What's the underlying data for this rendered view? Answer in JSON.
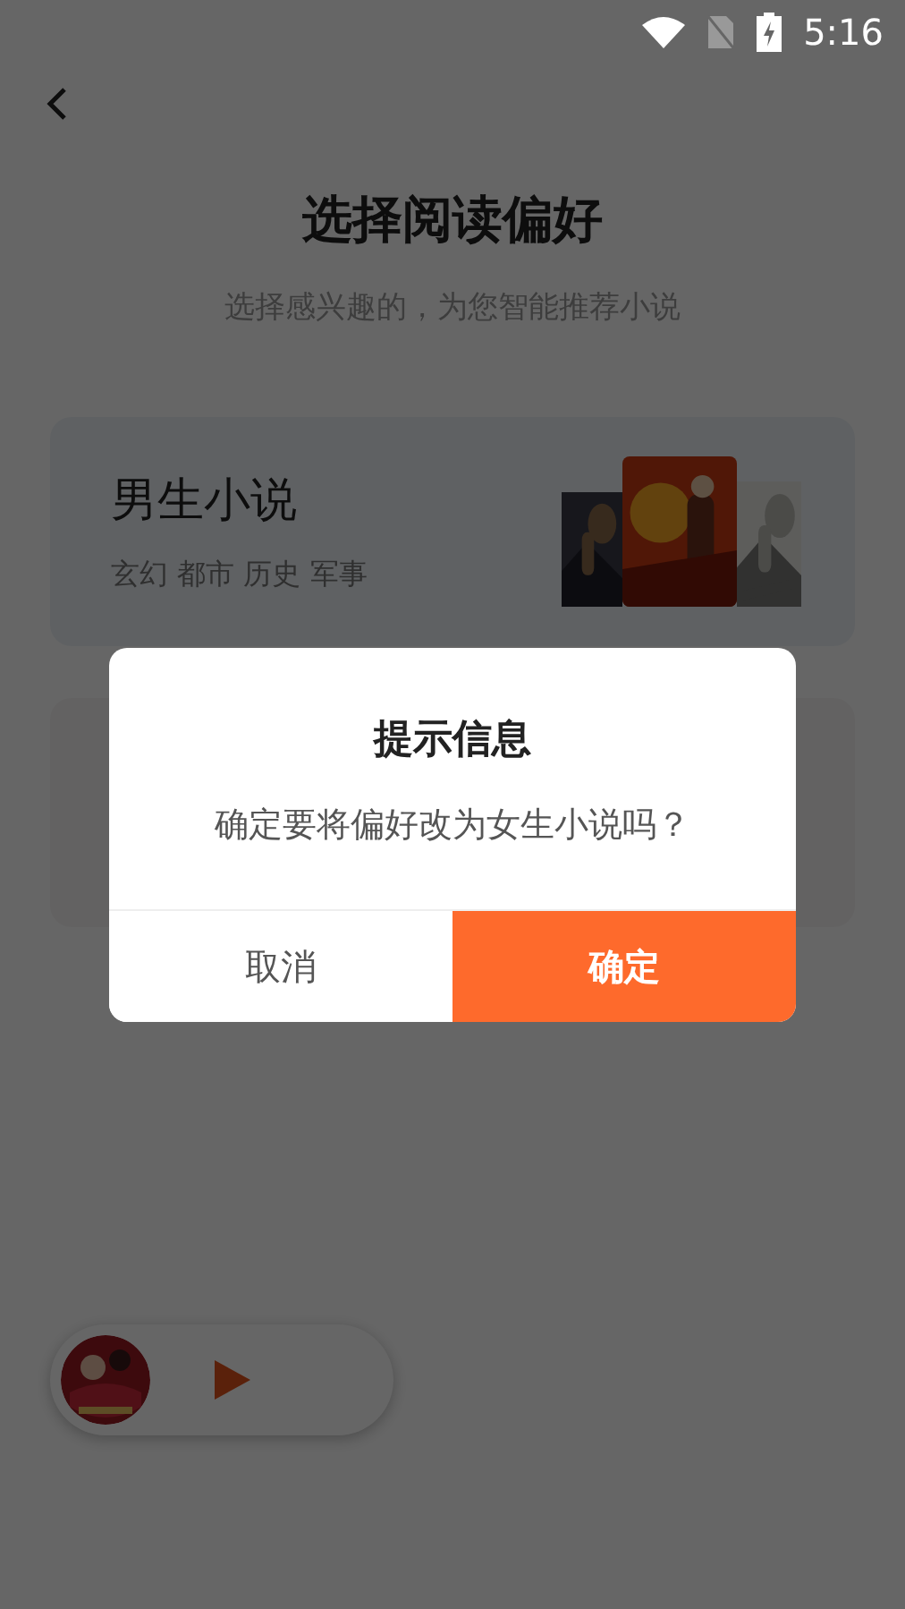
{
  "status_bar": {
    "time": "5:16"
  },
  "header": {
    "title": "选择阅读偏好",
    "subtitle": "选择感兴趣的，为您智能推荐小说"
  },
  "categories": [
    {
      "name": "男生小说",
      "tags": "玄幻 都市 历史 军事"
    }
  ],
  "player": {
    "playing": false
  },
  "dialog": {
    "title": "提示信息",
    "message": "确定要将偏好改为女生小说吗？",
    "buttons": [
      {
        "label": "取消",
        "kind": "secondary"
      },
      {
        "label": "确定",
        "kind": "primary"
      }
    ]
  }
}
